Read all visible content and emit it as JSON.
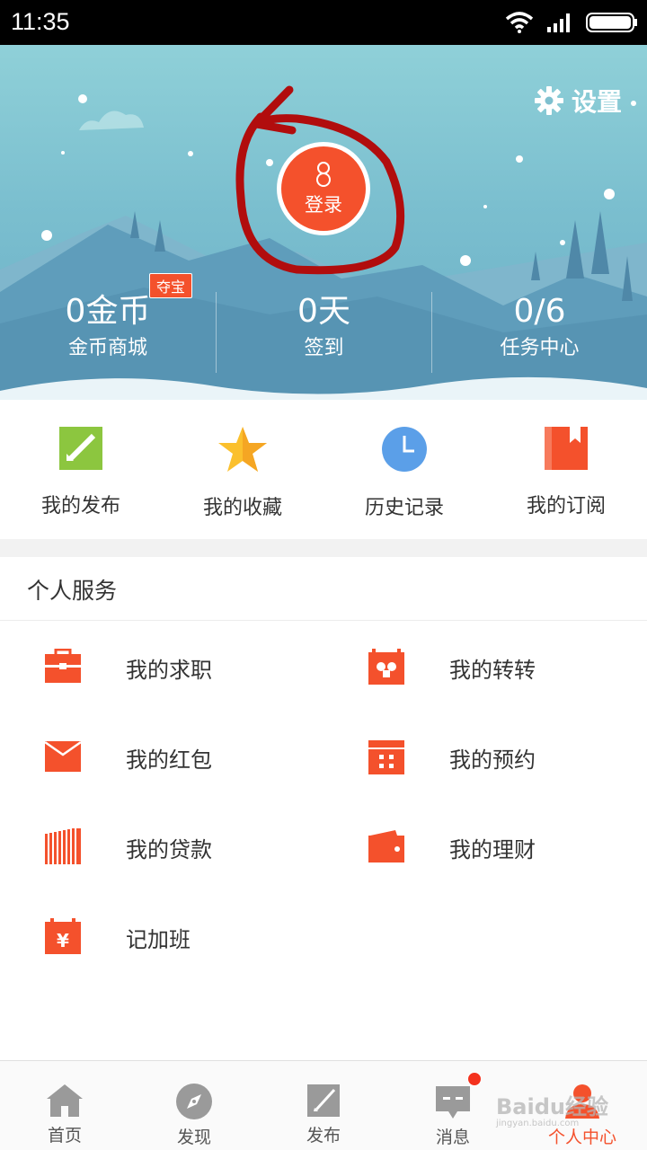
{
  "status_bar": {
    "time": "11:35"
  },
  "header": {
    "settings_label": "设置",
    "login_label": "登录",
    "badge": "夺宝",
    "stats": [
      {
        "value": "0金币",
        "label": "金币商城"
      },
      {
        "value": "0天",
        "label": "签到"
      },
      {
        "value": "0/6",
        "label": "任务中心"
      }
    ]
  },
  "quick": [
    {
      "label": "我的发布",
      "icon": "edit-note-icon"
    },
    {
      "label": "我的收藏",
      "icon": "star-icon"
    },
    {
      "label": "历史记录",
      "icon": "clock-icon"
    },
    {
      "label": "我的订阅",
      "icon": "bookmark-icon"
    }
  ],
  "services": {
    "title": "个人服务",
    "items": [
      {
        "label": "我的求职",
        "icon": "briefcase-icon"
      },
      {
        "label": "我的转转",
        "icon": "calendar-face-icon"
      },
      {
        "label": "我的红包",
        "icon": "envelope-icon"
      },
      {
        "label": "我的预约",
        "icon": "calendar-dots-icon"
      },
      {
        "label": "我的贷款",
        "icon": "money-stack-icon"
      },
      {
        "label": "我的理财",
        "icon": "wallet-icon"
      },
      {
        "label": "记加班",
        "icon": "calendar-yen-icon"
      }
    ]
  },
  "tabs": [
    {
      "label": "首页",
      "icon": "home-icon"
    },
    {
      "label": "发现",
      "icon": "compass-icon"
    },
    {
      "label": "发布",
      "icon": "edit-icon"
    },
    {
      "label": "消息",
      "icon": "message-icon"
    },
    {
      "label": "个人中心",
      "icon": "person-icon",
      "active": true
    }
  ],
  "watermark": {
    "main": "Baidu经验",
    "sub": "jingyan.baidu.com"
  },
  "colors": {
    "accent": "#f4512c",
    "header_top": "#8fd0d8",
    "header_bottom": "#6aaec6"
  }
}
